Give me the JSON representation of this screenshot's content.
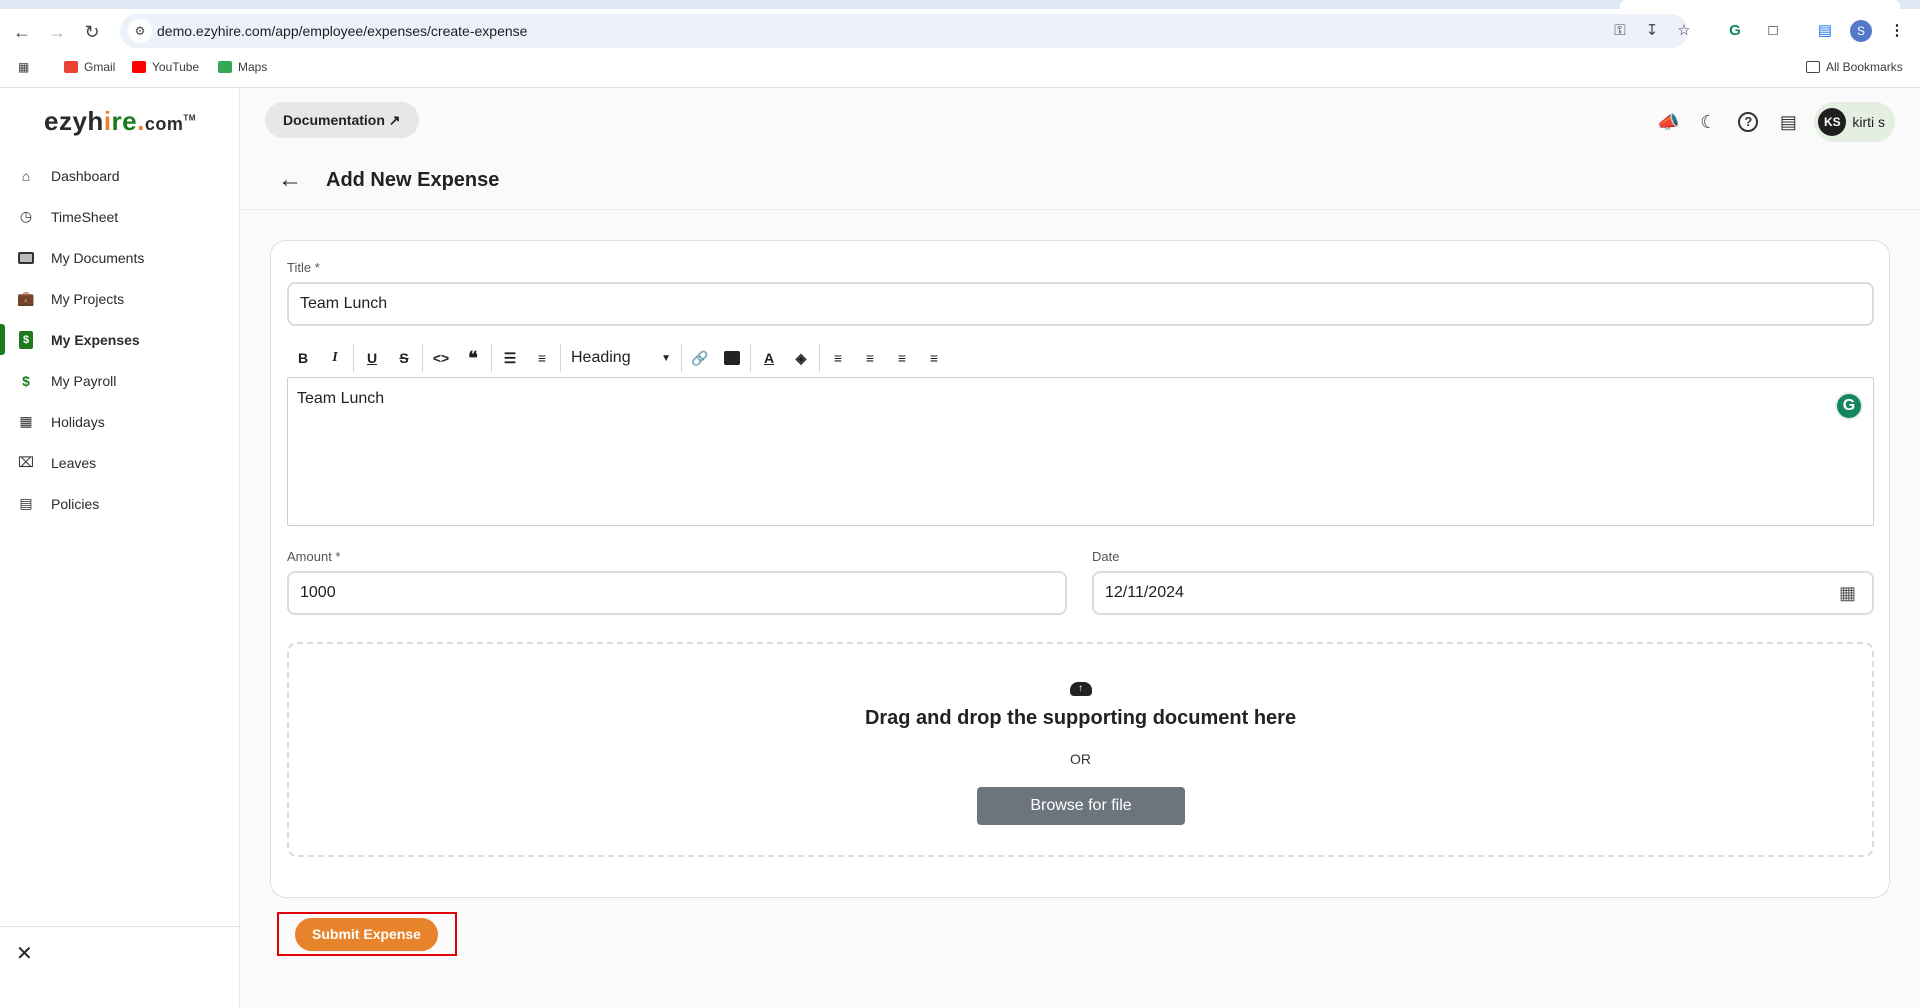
{
  "browser": {
    "url": "demo.ezyhire.com/app/employee/expenses/create-expense",
    "bookmarks": [
      "Gmail",
      "YouTube",
      "Maps"
    ],
    "all_bookmarks": "All Bookmarks",
    "profile_initial": "S"
  },
  "app": {
    "logo": {
      "part1": "ezyh",
      "part2": "i",
      "part3": "r",
      "part4": "e",
      "dot": ".",
      "part5": "com",
      "tm": "TM"
    }
  },
  "sidebar": {
    "items": [
      {
        "label": "Dashboard",
        "icon": "home-icon",
        "active": false
      },
      {
        "label": "TimeSheet",
        "icon": "clock-icon",
        "active": false
      },
      {
        "label": "My Documents",
        "icon": "folder-icon",
        "active": false
      },
      {
        "label": "My Projects",
        "icon": "briefcase-clock-icon",
        "active": false
      },
      {
        "label": "My Expenses",
        "icon": "expense-document-icon",
        "active": true
      },
      {
        "label": "My Payroll",
        "icon": "payroll-sync-icon",
        "active": false
      },
      {
        "label": "Holidays",
        "icon": "calendar-icon",
        "active": false
      },
      {
        "label": "Leaves",
        "icon": "calendar-x-icon",
        "active": false
      },
      {
        "label": "Policies",
        "icon": "policy-document-icon",
        "active": false
      }
    ],
    "close_icon": "close-icon"
  },
  "header": {
    "documentation_label": "Documentation",
    "user": {
      "initials": "KS",
      "name": "kirti s"
    }
  },
  "page": {
    "title": "Add New Expense"
  },
  "form": {
    "title_label": "Title *",
    "title_value": "Team Lunch",
    "editor_heading_select": "Heading",
    "editor_content": "Team Lunch",
    "amount_label": "Amount *",
    "amount_value": "1000",
    "date_label": "Date",
    "date_value": "12/11/2024",
    "dropzone_text": "Drag and drop the supporting document here",
    "or_text": "OR",
    "browse_label": "Browse for file",
    "submit_label": "Submit Expense"
  },
  "colors": {
    "brand_green": "#1d7a1d",
    "accent_orange": "#e7832a",
    "highlight_red": "#e0000a",
    "browse_gray": "#6c757d"
  }
}
